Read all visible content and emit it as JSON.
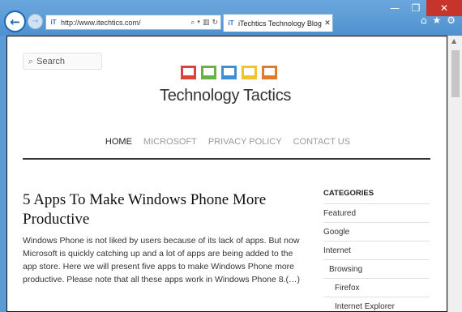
{
  "browser": {
    "address": {
      "favicon": "iT",
      "url": "http://www.itechtics.com/"
    },
    "tab": {
      "favicon": "iT",
      "title": "iTechtics Technology Blog - ..."
    },
    "window_controls": {
      "minimize": "—",
      "restore": "❐",
      "close": "✕"
    },
    "icons": {
      "back": "←",
      "forward": "→",
      "home": "⌂",
      "favorites": "★",
      "settings": "⚙",
      "search": "⌕",
      "compat": "▥",
      "refresh": "↻",
      "tab_close": "✕"
    }
  },
  "page": {
    "search": {
      "placeholder": "Search"
    },
    "logo": {
      "text": "Technology Tactics",
      "frame_colors": [
        "#d9453c",
        "#6ab245",
        "#3f8ed8",
        "#f2c230",
        "#e07b2e"
      ]
    },
    "menu": [
      {
        "label": "HOME",
        "active": true
      },
      {
        "label": "MICROSOFT",
        "active": false
      },
      {
        "label": "PRIVACY POLICY",
        "active": false
      },
      {
        "label": "CONTACT US",
        "active": false
      }
    ],
    "article": {
      "title": "5 Apps To Make Windows Phone More Productive",
      "excerpt": "Windows Phone is not liked by users because of its lack of apps. But now Microsoft is quickly catching up and a lot of apps are being added to the app store. Here we will present five apps to make Windows Phone more productive. Please note that all these apps work in Windows Phone 8.(…)"
    },
    "sidebar": {
      "heading": "CATEGORIES",
      "categories": [
        {
          "label": "Featured",
          "level": 0
        },
        {
          "label": "Google",
          "level": 0
        },
        {
          "label": "Internet",
          "level": 0
        },
        {
          "label": "Browsing",
          "level": 1
        },
        {
          "label": "Firefox",
          "level": 2
        },
        {
          "label": "Internet Explorer",
          "level": 2
        }
      ]
    }
  }
}
